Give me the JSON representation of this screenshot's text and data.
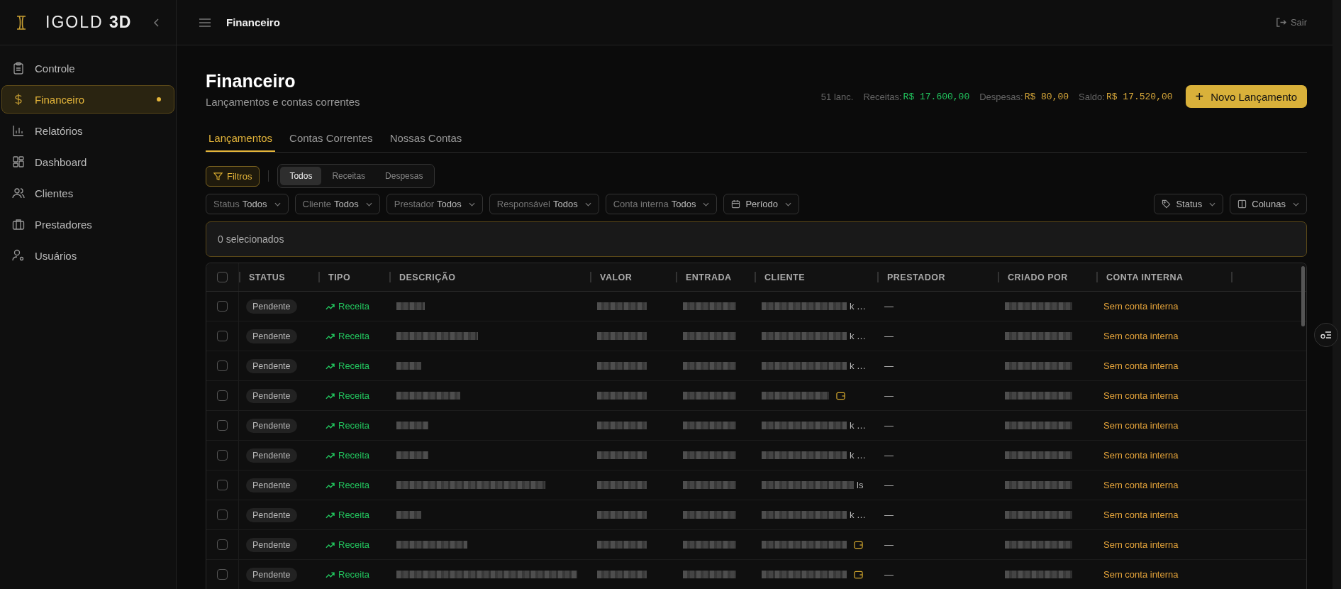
{
  "brand": {
    "name": "IGOLD",
    "suffix": "3D"
  },
  "sidebar": {
    "items": [
      {
        "label": "Controle",
        "selected": false
      },
      {
        "label": "Financeiro",
        "selected": true
      },
      {
        "label": "Relatórios",
        "selected": false
      },
      {
        "label": "Dashboard",
        "selected": false
      },
      {
        "label": "Clientes",
        "selected": false
      },
      {
        "label": "Prestadores",
        "selected": false
      },
      {
        "label": "Usuários",
        "selected": false
      }
    ]
  },
  "topbar": {
    "title": "Financeiro",
    "logout": "Sair"
  },
  "page": {
    "title": "Financeiro",
    "subtitle": "Lançamentos e contas correntes"
  },
  "summary": {
    "count": "51 lanc.",
    "income_label": "Receitas:",
    "income": "R$ 17.600,00",
    "expense_label": "Despesas:",
    "expense": "R$ 80,00",
    "balance_label": "Saldo:",
    "balance": "R$ 17.520,00"
  },
  "new_button": {
    "icon": "+",
    "label": "Novo Lançamento"
  },
  "tabs": [
    {
      "label": "Lançamentos",
      "selected": true
    },
    {
      "label": "Contas Correntes",
      "selected": false
    },
    {
      "label": "Nossas Contas",
      "selected": false
    }
  ],
  "filters_button": "Filtros",
  "type_toggle": [
    {
      "label": "Todos",
      "selected": true
    },
    {
      "label": "Receitas",
      "selected": false
    },
    {
      "label": "Despesas",
      "selected": false
    }
  ],
  "dropdowns": [
    {
      "label": "Status",
      "value": "Todos"
    },
    {
      "label": "Cliente",
      "value": "Todos"
    },
    {
      "label": "Prestador",
      "value": "Todos"
    },
    {
      "label": "Responsável",
      "value": "Todos"
    },
    {
      "label": "Conta interna",
      "value": "Todos"
    }
  ],
  "period": "Período",
  "right_buttons": [
    "Status",
    "Colunas"
  ],
  "selection": "0 selecionados",
  "table": {
    "select_all_checked": false,
    "columns": [
      "STATUS",
      "TIPO",
      "DESCRIÇÃO",
      "VALOR",
      "ENTRADA",
      "CLIENTE",
      "PRESTADOR",
      "CRIADO POR",
      "CONTA INTERNA"
    ],
    "rows": [
      {
        "checked": false,
        "status": "Pendente",
        "type": "Receita",
        "client_tail": "k …",
        "wallet_icon": false,
        "provider": "—",
        "account": "Sem conta interna"
      },
      {
        "checked": false,
        "status": "Pendente",
        "type": "Receita",
        "client_tail": "k …",
        "wallet_icon": false,
        "provider": "—",
        "account": "Sem conta interna"
      },
      {
        "checked": false,
        "status": "Pendente",
        "type": "Receita",
        "client_tail": "k …",
        "wallet_icon": false,
        "provider": "—",
        "account": "Sem conta interna"
      },
      {
        "checked": false,
        "status": "Pendente",
        "type": "Receita",
        "wallet_icon": true,
        "provider": "—",
        "account": "Sem conta interna"
      },
      {
        "checked": false,
        "status": "Pendente",
        "type": "Receita",
        "client_tail": "k …",
        "wallet_icon": false,
        "provider": "—",
        "account": "Sem conta interna"
      },
      {
        "checked": false,
        "status": "Pendente",
        "type": "Receita",
        "client_tail": "k …",
        "wallet_icon": false,
        "provider": "—",
        "account": "Sem conta interna"
      },
      {
        "checked": false,
        "status": "Pendente",
        "type": "Receita",
        "client_tail": "ls",
        "wallet_icon": false,
        "provider": "—",
        "account": "Sem conta interna"
      },
      {
        "checked": false,
        "status": "Pendente",
        "type": "Receita",
        "client_tail": "k …",
        "wallet_icon": false,
        "provider": "—",
        "account": "Sem conta interna"
      },
      {
        "checked": false,
        "status": "Pendente",
        "type": "Receita",
        "wallet_icon": true,
        "provider": "—",
        "account": "Sem conta interna"
      },
      {
        "checked": false,
        "status": "Pendente",
        "type": "Receita",
        "wallet_icon": true,
        "provider": "—",
        "account": "Sem conta interna"
      }
    ]
  }
}
